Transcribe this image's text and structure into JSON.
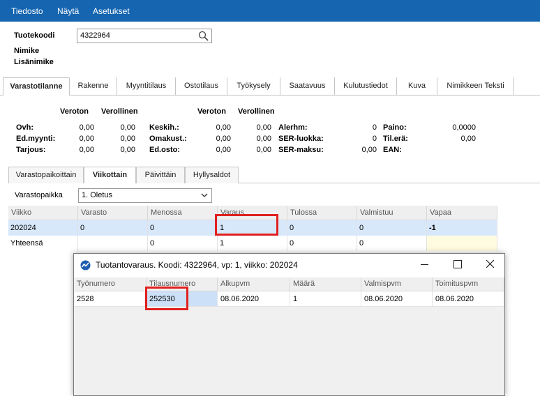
{
  "menubar": {
    "items": [
      "Tiedosto",
      "Näytä",
      "Asetukset"
    ]
  },
  "header": {
    "code_label": "Tuotekoodi",
    "code_value": "4322964",
    "name_label": "Nimike",
    "extra_name_label": "Lisänimike"
  },
  "main_tabs": [
    "Varastotilanne",
    "Rakenne",
    "Myyntitilaus",
    "Ostotilaus",
    "Työkysely",
    "Saatavuus",
    "Kulutustiedot",
    "Kuva",
    "Nimikkeen Teksti"
  ],
  "summary": {
    "col_headers": [
      "Veroton",
      "Verollinen",
      "Veroton",
      "Verollinen"
    ],
    "left": [
      {
        "label": "Ovh:",
        "veroton": "0,00",
        "verollinen": "0,00"
      },
      {
        "label": "Ed.myynti:",
        "veroton": "0,00",
        "verollinen": "0,00"
      },
      {
        "label": "Tarjous:",
        "veroton": "0,00",
        "verollinen": "0,00"
      }
    ],
    "middle": [
      {
        "label": "Keskih.:",
        "veroton": "0,00",
        "verollinen": "0,00"
      },
      {
        "label": "Omakust.:",
        "veroton": "0,00",
        "verollinen": "0,00"
      },
      {
        "label": "Ed.osto:",
        "veroton": "0,00",
        "verollinen": "0,00"
      }
    ],
    "right": [
      {
        "label": "Alerhm:",
        "value": "0"
      },
      {
        "label": "SER-luokka:",
        "value": "0"
      },
      {
        "label": "SER-maksu:",
        "value": "0,00"
      }
    ],
    "far": [
      {
        "label": "Paino:",
        "value": "0,0000"
      },
      {
        "label": "Til.erä:",
        "value": "0,00"
      },
      {
        "label": "EAN:",
        "value": ""
      }
    ]
  },
  "sub_tabs": [
    "Varastopaikoittain",
    "Viikottain",
    "Päivittäin",
    "Hyllysaldot"
  ],
  "warehouse": {
    "label": "Varastopaikka",
    "value": "1. Oletus"
  },
  "grid": {
    "headers": [
      "Viikko",
      "Varasto",
      "Menossa",
      "Varaus",
      "Tulossa",
      "Valmistuu",
      "Vapaa"
    ],
    "row": [
      "202024",
      "0",
      "0",
      "1",
      "0",
      "0",
      "-1"
    ],
    "totals": [
      "Yhteensä",
      "",
      "0",
      "1",
      "0",
      "0",
      ""
    ]
  },
  "dialog": {
    "title": "Tuotantovaraus. Koodi: 4322964, vp: 1, viikko: 202024",
    "headers": [
      "Työnumero",
      "Tilausnumero",
      "Alkupvm",
      "Määrä",
      "Valmispvm",
      "Toimituspvm"
    ],
    "row": [
      "2528",
      "252530",
      "08.06.2020",
      "1",
      "08.06.2020",
      "08.06.2020"
    ]
  },
  "colors": {
    "menubar": "#1565b0",
    "highlight_row": "#d8e8fb",
    "annotation": "#e0201f"
  }
}
